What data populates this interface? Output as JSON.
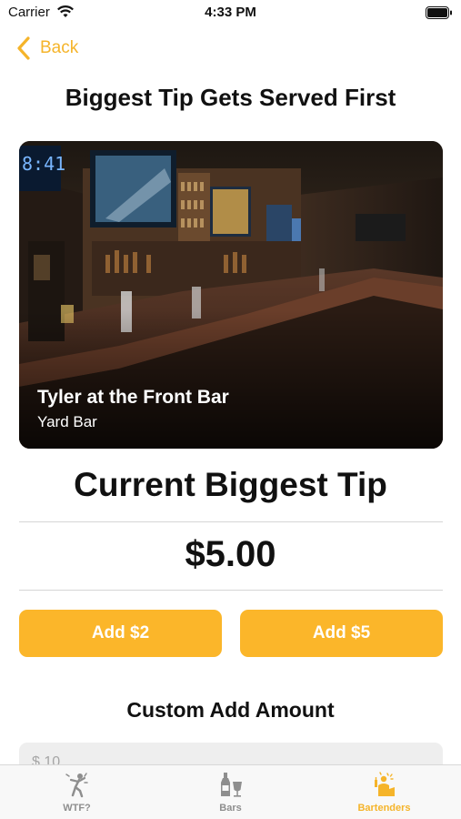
{
  "status_bar": {
    "carrier": "Carrier",
    "time": "4:33 PM"
  },
  "nav": {
    "back_label": "Back"
  },
  "page_title": "Biggest Tip Gets Served First",
  "hero": {
    "bartender_name": "Tyler at the Front Bar",
    "venue": "Yard Bar",
    "image_description": "bar-interior-photo"
  },
  "tip": {
    "section_title": "Current Biggest Tip",
    "amount": "$5.00"
  },
  "buttons": {
    "add_2": "Add $2",
    "add_5": "Add $5"
  },
  "custom": {
    "title": "Custom Add Amount",
    "placeholder": "$ 10"
  },
  "tabs": [
    {
      "label": "WTF?",
      "icon": "person-dancing-icon",
      "active": false
    },
    {
      "label": "Bars",
      "icon": "bottle-glass-icon",
      "active": false
    },
    {
      "label": "Bartenders",
      "icon": "bartender-icon",
      "active": true
    }
  ],
  "colors": {
    "accent": "#fbb62a",
    "accent_text": "#f5b42a",
    "inactive_tab": "#8e8e8e"
  }
}
